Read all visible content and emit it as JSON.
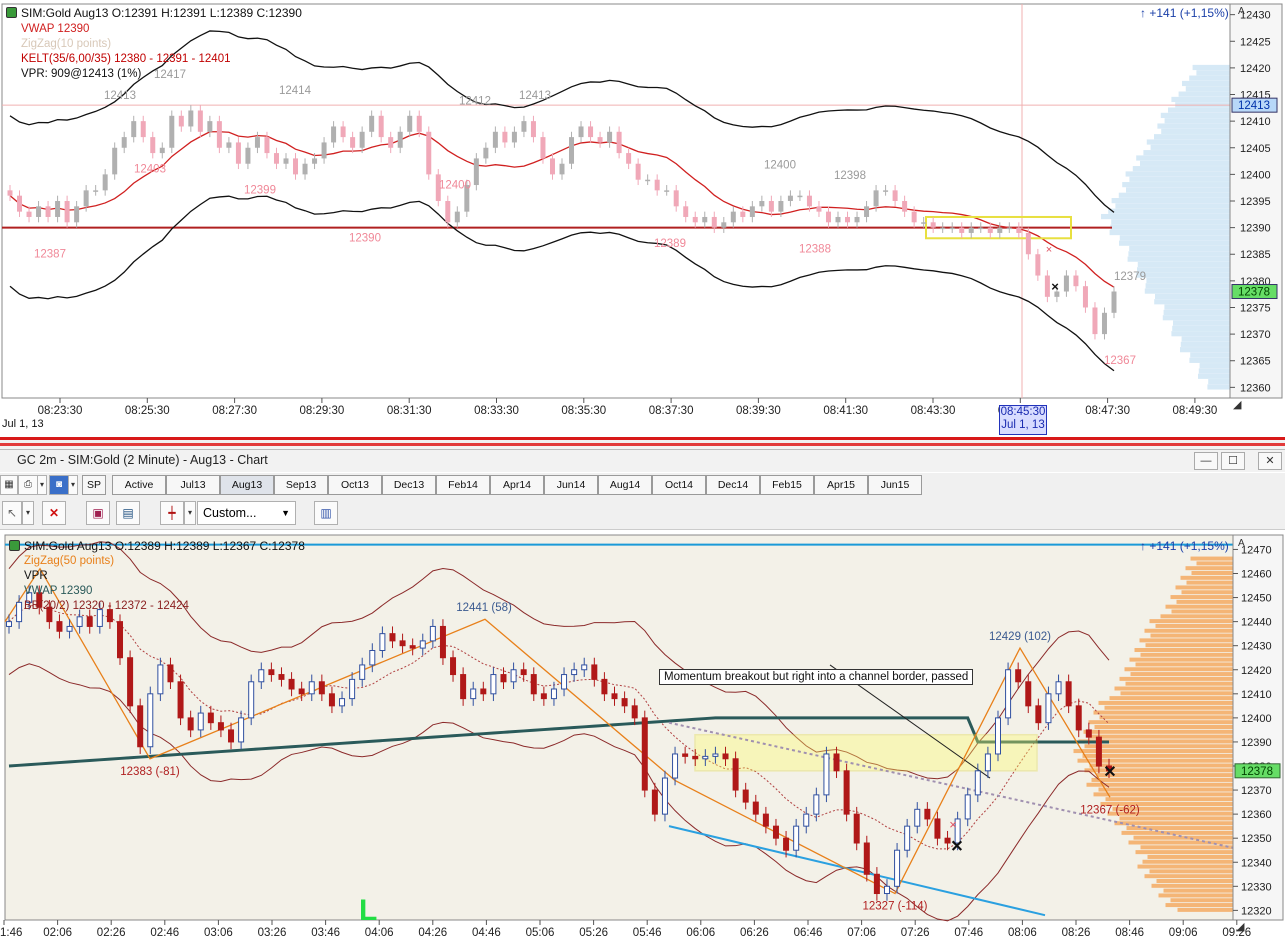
{
  "top_chart": {
    "header": "SIM:Gold Aug13 O:12391 H:12391 L:12389 C:12390",
    "change": "+141 (+1,15%)",
    "legend": [
      {
        "text": "VWAP  12390",
        "color": "#d02020"
      },
      {
        "text": "ZigZag(10 points)",
        "color": "#d8c8b8"
      },
      {
        "text": "KELT(35/6,00/35) 12380 - 12391 - 12401",
        "color": "#c00000"
      },
      {
        "text": "VPR: 909@12413 (1%)",
        "color": "#111111"
      }
    ],
    "price_badges": [
      {
        "text": "12413",
        "price": 12413,
        "bg": "#b8d8f8",
        "fg": "#0033aa"
      },
      {
        "text": "12378",
        "price": 12378,
        "bg": "#66dd66",
        "fg": "#004400"
      }
    ],
    "date_label": "Jul 1, 13",
    "cursor_time": "08:45:30",
    "cursor_date": "Jul 1, 13"
  },
  "window": {
    "title": "GC 2m - SIM:Gold (2 Minute) - Aug13 - Chart",
    "minimize_glyph": "—",
    "maximize_glyph": "☐",
    "close_glyph": "✕"
  },
  "tabs": [
    "SP",
    "Active",
    "Jul13",
    "Aug13",
    "Sep13",
    "Oct13",
    "Dec13",
    "Feb14",
    "Apr14",
    "Jun14",
    "Aug14",
    "Oct14",
    "Dec14",
    "Feb15",
    "Apr15",
    "Jun15"
  ],
  "selected_tab": "Aug13",
  "toolbar": {
    "template_select": "Custom...",
    "icons": [
      "properties-icon",
      "print-icon",
      "screenshot-icon",
      "cursor-icon",
      "delete-icon",
      "indicators-icon",
      "strategies-icon",
      "chart-style-icon",
      "data-box-icon"
    ]
  },
  "bottom_chart": {
    "header": "SIM:Gold Aug13 O:12389 H:12389 L:12367 C:12378",
    "change": "+141 (+1,15%)",
    "legend": [
      {
        "text": "ZigZag(50 points)",
        "color": "#e8801a"
      },
      {
        "text": "VPR",
        "color": "#111111"
      },
      {
        "text": "VWAP  12390",
        "color": "#2a5a5a"
      },
      {
        "text": "BB(20/2) 12320 - 12372 - 12424",
        "color": "#8b2020"
      }
    ],
    "annotation": "Momentum breakout but right into a channel border, passed",
    "price_badge": {
      "text": "12378",
      "price": 12378,
      "bg": "#66dd66",
      "fg": "#004400"
    },
    "marker_letter": "L"
  },
  "colors": {
    "bull_top": "#b0b0b0",
    "bear_top": "#f0a8b8",
    "bull_bottom": "#3050a0",
    "bear_bottom": "#b01818",
    "volume_top": "#cce4f4",
    "volume_bottom": "#f4a050",
    "zone": "#ffff66"
  },
  "chart_data": [
    {
      "type": "candlestick",
      "title": "SIM:Gold Aug13 (top)",
      "x_ticks": [
        "08:23:30",
        "08:25:30",
        "08:27:30",
        "08:29:30",
        "08:31:30",
        "08:33:30",
        "08:35:30",
        "08:37:30",
        "08:39:30",
        "08:41:30",
        "08:43:30",
        "08:45:30",
        "08:47:30",
        "08:49:30"
      ],
      "y_ticks": [
        12360,
        12365,
        12370,
        12375,
        12380,
        12385,
        12390,
        12395,
        12400,
        12405,
        12410,
        12415,
        12420,
        12425,
        12430
      ],
      "ylim": [
        12358,
        12432
      ],
      "zigzag_labels": [
        {
          "text": "12413",
          "price": 12413,
          "t": 1.0,
          "pos": "above"
        },
        {
          "text": "12417",
          "price": 12417,
          "t": 2.0,
          "pos": "above"
        },
        {
          "text": "12414",
          "price": 12414,
          "t": 4.5,
          "pos": "above"
        },
        {
          "text": "12412",
          "price": 12412,
          "t": 8.1,
          "pos": "above"
        },
        {
          "text": "12413",
          "price": 12413,
          "t": 9.3,
          "pos": "above"
        },
        {
          "text": "12400",
          "price": 12400,
          "t": 14.2,
          "pos": "above"
        },
        {
          "text": "12398",
          "price": 12398,
          "t": 15.6,
          "pos": "above"
        },
        {
          "text": "12379",
          "price": 12379,
          "t": 21.2,
          "pos": "above"
        },
        {
          "text": "12403",
          "price": 12403,
          "t": 1.6,
          "pos": "below"
        },
        {
          "text": "12399",
          "price": 12399,
          "t": 3.8,
          "pos": "below"
        },
        {
          "text": "12387",
          "price": 12387,
          "t": -0.4,
          "pos": "below"
        },
        {
          "text": "12390",
          "price": 12390,
          "t": 5.9,
          "pos": "below"
        },
        {
          "text": "12400",
          "price": 12400,
          "t": 7.7,
          "pos": "below"
        },
        {
          "text": "12389",
          "price": 12389,
          "t": 12.0,
          "pos": "below"
        },
        {
          "text": "12388",
          "price": 12388,
          "t": 14.9,
          "pos": "below"
        },
        {
          "text": "12367",
          "price": 12367,
          "t": 21.0,
          "pos": "below"
        }
      ],
      "closes": [
        12396,
        12393,
        12392,
        12394,
        12392,
        12395,
        12391,
        12394,
        12397,
        12397,
        12400,
        12405,
        12407,
        12410,
        12407,
        12404,
        12405,
        12411,
        12409,
        12412,
        12408,
        12410,
        12405,
        12406,
        12402,
        12405,
        12407,
        12404,
        12402,
        12403,
        12400,
        12402,
        12403,
        12406,
        12409,
        12407,
        12405,
        12408,
        12411,
        12407,
        12405,
        12408,
        12411,
        12408,
        12400,
        12395,
        12391,
        12393,
        12398,
        12403,
        12405,
        12408,
        12406,
        12408,
        12410,
        12407,
        12403,
        12400,
        12402,
        12407,
        12409,
        12407,
        12406,
        12408,
        12404,
        12402,
        12399,
        12399,
        12397,
        12397,
        12394,
        12392,
        12391,
        12392,
        12390,
        12391,
        12393,
        12392,
        12394,
        12395,
        12393,
        12395,
        12396,
        12396,
        12394,
        12393,
        12391,
        12392,
        12391,
        12392,
        12394,
        12397,
        12397,
        12395,
        12393,
        12391,
        12391,
        12390,
        12390,
        12390,
        12389,
        12390,
        12390,
        12389,
        12390,
        12390,
        12389,
        12385,
        12381,
        12377,
        12378,
        12381,
        12379,
        12375,
        12370,
        12374,
        12378
      ],
      "vwap": 12390,
      "vpr_level": 12413
    },
    {
      "type": "candlestick",
      "title": "SIM:Gold Aug13 2 Minute (bottom)",
      "x_ticks": [
        "1:46",
        "02:06",
        "02:26",
        "02:46",
        "03:06",
        "03:26",
        "03:46",
        "04:06",
        "04:26",
        "04:46",
        "05:06",
        "05:26",
        "05:46",
        "06:06",
        "06:26",
        "06:46",
        "07:06",
        "07:26",
        "07:46",
        "08:06",
        "08:26",
        "08:46",
        "09:06",
        "09:26"
      ],
      "y_ticks": [
        12320,
        12330,
        12340,
        12350,
        12360,
        12370,
        12380,
        12390,
        12400,
        12410,
        12420,
        12430,
        12440,
        12450,
        12460,
        12470
      ],
      "ylim": [
        12316,
        12476
      ],
      "zigzag_labels": [
        {
          "text": "12441 (58)",
          "price": 12441,
          "t": "04:46",
          "pos": "above"
        },
        {
          "text": "12429 (102)",
          "price": 12429,
          "t": "08:06",
          "pos": "above"
        },
        {
          "text": "12383 (-81)",
          "price": 12383,
          "t": "02:46",
          "pos": "below"
        },
        {
          "text": "12327 (-114)",
          "price": 12327,
          "t": "07:26",
          "pos": "below"
        },
        {
          "text": "12367 (-62)",
          "price": 12367,
          "t": "08:46",
          "pos": "below"
        }
      ],
      "closes": [
        12440,
        12448,
        12452,
        12446,
        12440,
        12436,
        12438,
        12442,
        12438,
        12445,
        12440,
        12425,
        12405,
        12388,
        12410,
        12422,
        12415,
        12400,
        12395,
        12402,
        12398,
        12395,
        12390,
        12400,
        12415,
        12420,
        12418,
        12416,
        12412,
        12410,
        12415,
        12410,
        12405,
        12408,
        12416,
        12422,
        12428,
        12435,
        12432,
        12430,
        12429,
        12432,
        12438,
        12425,
        12418,
        12408,
        12412,
        12410,
        12418,
        12415,
        12420,
        12418,
        12410,
        12408,
        12412,
        12418,
        12420,
        12422,
        12416,
        12410,
        12408,
        12405,
        12400,
        12370,
        12360,
        12375,
        12385,
        12384,
        12383,
        12384,
        12385,
        12383,
        12370,
        12365,
        12360,
        12355,
        12350,
        12345,
        12355,
        12360,
        12368,
        12385,
        12378,
        12360,
        12348,
        12335,
        12327,
        12330,
        12345,
        12355,
        12362,
        12358,
        12350,
        12348,
        12358,
        12368,
        12378,
        12385,
        12400,
        12420,
        12415,
        12405,
        12398,
        12410,
        12415,
        12405,
        12395,
        12392,
        12380,
        12378
      ],
      "vwap": 12390,
      "bb": {
        "lower": 12320,
        "mid": 12372,
        "upper": 12424
      }
    }
  ]
}
